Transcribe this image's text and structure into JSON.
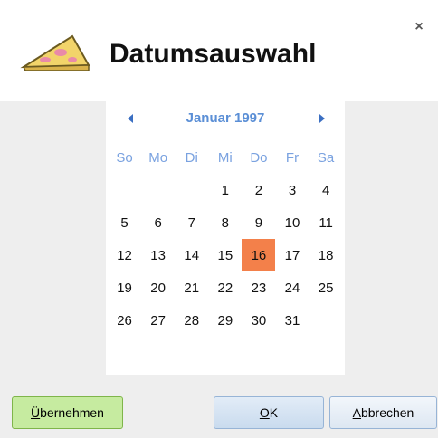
{
  "dialog": {
    "title": "Datumsauswahl",
    "close_glyph": "×",
    "icon": "cheese-icon"
  },
  "calendar": {
    "month_label": "Januar 1997",
    "weekdays": [
      "So",
      "Mo",
      "Di",
      "Mi",
      "Do",
      "Fr",
      "Sa"
    ],
    "leading_blanks": 3,
    "days": [
      1,
      2,
      3,
      4,
      5,
      6,
      7,
      8,
      9,
      10,
      11,
      12,
      13,
      14,
      15,
      16,
      17,
      18,
      19,
      20,
      21,
      22,
      23,
      24,
      25,
      26,
      27,
      28,
      29,
      30,
      31
    ],
    "selected_day": 16,
    "selected_color": "#f3804a",
    "header_color": "#5b8fd6"
  },
  "buttons": {
    "apply": {
      "mnemonic": "Ü",
      "rest": "bernehmen"
    },
    "ok": {
      "mnemonic": "O",
      "rest": "K"
    },
    "cancel": {
      "mnemonic": "A",
      "rest": "bbrechen"
    }
  }
}
